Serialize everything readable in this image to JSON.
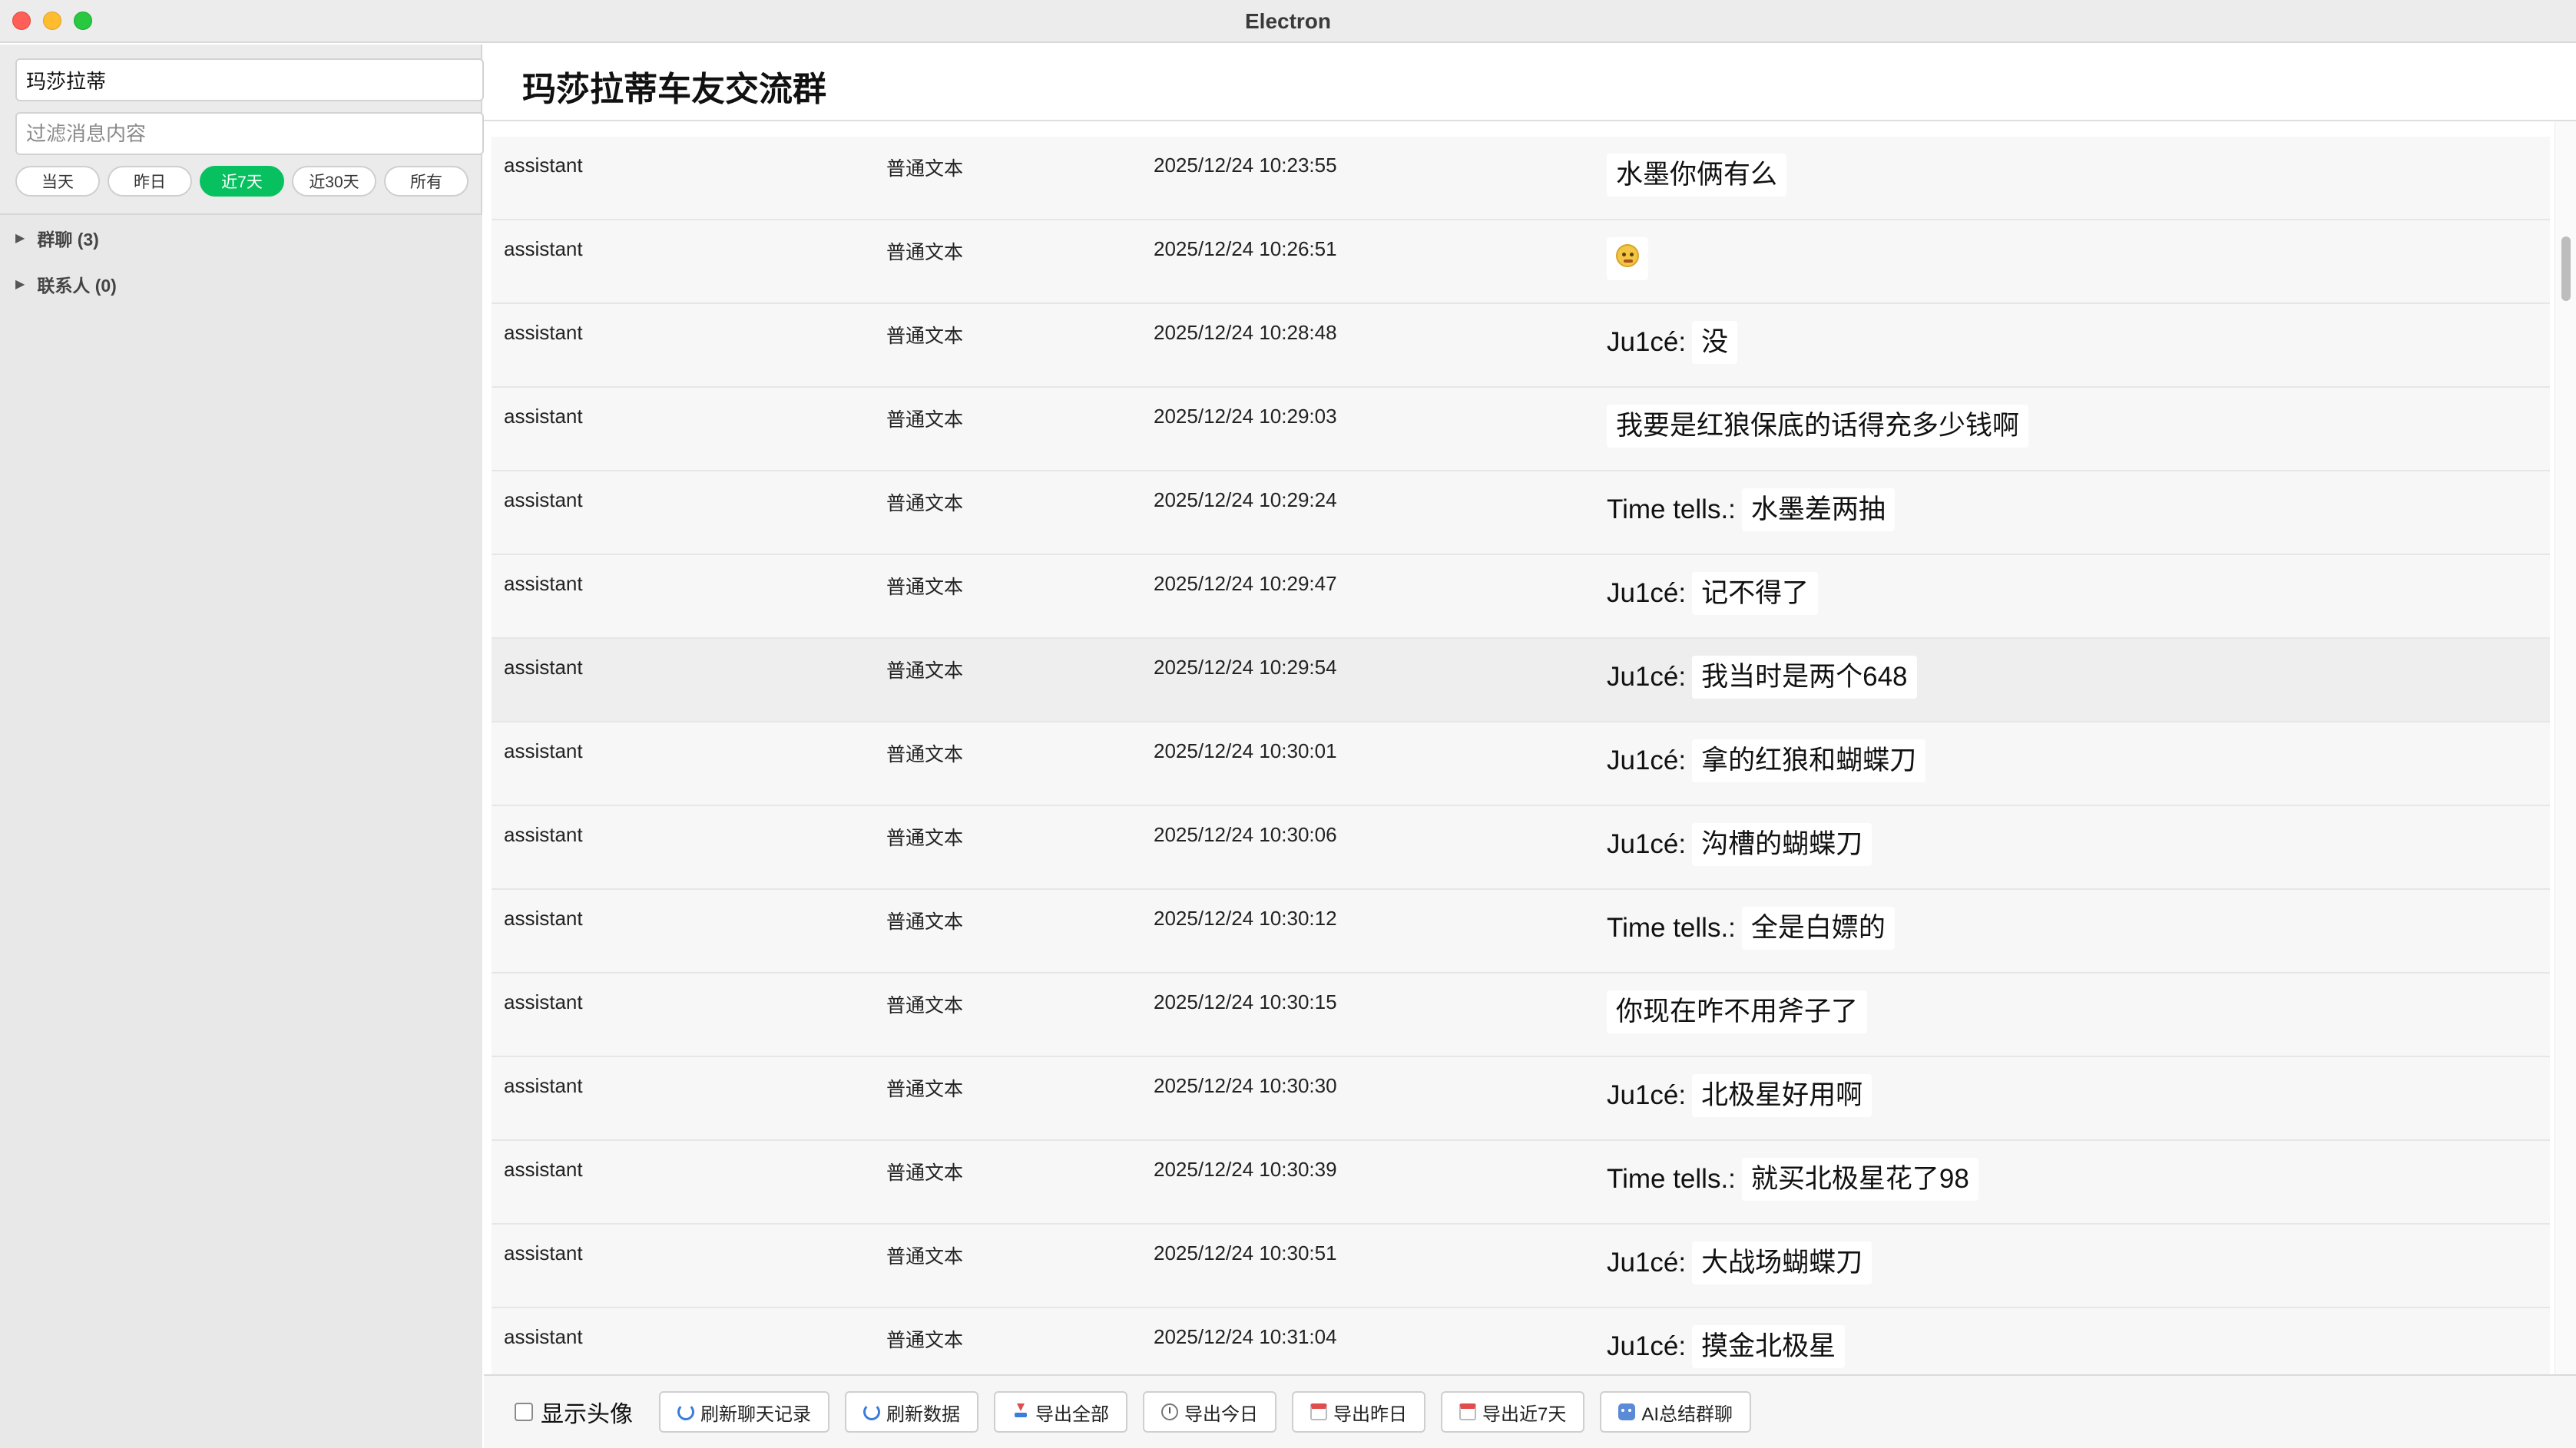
{
  "window": {
    "title": "Electron"
  },
  "sidebar": {
    "search_value": "玛莎拉蒂",
    "filter_placeholder": "过滤消息内容",
    "ranges": [
      "当天",
      "昨日",
      "近7天",
      "近30天",
      "所有"
    ],
    "active_range": "近7天",
    "tree": [
      {
        "label": "群聊 (3)"
      },
      {
        "label": "联系人 (0)"
      }
    ]
  },
  "chat": {
    "title": "玛莎拉蒂车友交流群",
    "messages": [
      {
        "sender": "assistant",
        "type": "普通文本",
        "time": "2025/12/24 10:23:55",
        "name": "",
        "text": "水墨你俩有么"
      },
      {
        "sender": "assistant",
        "type": "普通文本",
        "time": "2025/12/24 10:26:51",
        "name": "",
        "text": "",
        "emoji": "flushed-face"
      },
      {
        "sender": "assistant",
        "type": "普通文本",
        "time": "2025/12/24 10:28:48",
        "name": "Ju1cé:",
        "text": "没"
      },
      {
        "sender": "assistant",
        "type": "普通文本",
        "time": "2025/12/24 10:29:03",
        "name": "",
        "text": "我要是红狼保底的话得充多少钱啊"
      },
      {
        "sender": "assistant",
        "type": "普通文本",
        "time": "2025/12/24 10:29:24",
        "name": "Time tells.:",
        "text": "水墨差两抽"
      },
      {
        "sender": "assistant",
        "type": "普通文本",
        "time": "2025/12/24 10:29:47",
        "name": "Ju1cé:",
        "text": "记不得了"
      },
      {
        "sender": "assistant",
        "type": "普通文本",
        "time": "2025/12/24 10:29:54",
        "name": "Ju1cé:",
        "text": "我当时是两个648"
      },
      {
        "sender": "assistant",
        "type": "普通文本",
        "time": "2025/12/24 10:30:01",
        "name": "Ju1cé:",
        "text": "拿的红狼和蝴蝶刀"
      },
      {
        "sender": "assistant",
        "type": "普通文本",
        "time": "2025/12/24 10:30:06",
        "name": "Ju1cé:",
        "text": "沟槽的蝴蝶刀"
      },
      {
        "sender": "assistant",
        "type": "普通文本",
        "time": "2025/12/24 10:30:12",
        "name": "Time tells.:",
        "text": "全是白嫖的"
      },
      {
        "sender": "assistant",
        "type": "普通文本",
        "time": "2025/12/24 10:30:15",
        "name": "",
        "text": "你现在咋不用斧子了"
      },
      {
        "sender": "assistant",
        "type": "普通文本",
        "time": "2025/12/24 10:30:30",
        "name": "Ju1cé:",
        "text": "北极星好用啊"
      },
      {
        "sender": "assistant",
        "type": "普通文本",
        "time": "2025/12/24 10:30:39",
        "name": "Time tells.:",
        "text": "就买北极星花了98"
      },
      {
        "sender": "assistant",
        "type": "普通文本",
        "time": "2025/12/24 10:30:51",
        "name": "Ju1cé:",
        "text": "大战场蝴蝶刀"
      },
      {
        "sender": "assistant",
        "type": "普通文本",
        "time": "2025/12/24 10:31:04",
        "name": "Ju1cé:",
        "text": "摸金北极星"
      }
    ]
  },
  "toolbar": {
    "show_avatar": "显示头像",
    "buttons": [
      {
        "label": "刷新聊天记录",
        "icon": "refresh-icon"
      },
      {
        "label": "刷新数据",
        "icon": "refresh-icon"
      },
      {
        "label": "导出全部",
        "icon": "download-icon"
      },
      {
        "label": "导出今日",
        "icon": "clock-icon"
      },
      {
        "label": "导出昨日",
        "icon": "calendar-icon"
      },
      {
        "label": "导出近7天",
        "icon": "calendar-icon"
      },
      {
        "label": "AI总结群聊",
        "icon": "robot-icon"
      }
    ]
  },
  "colors": {
    "accent": "#07c160",
    "close": "#fe5f57",
    "minimize": "#febc2e",
    "maximize": "#28c840"
  }
}
